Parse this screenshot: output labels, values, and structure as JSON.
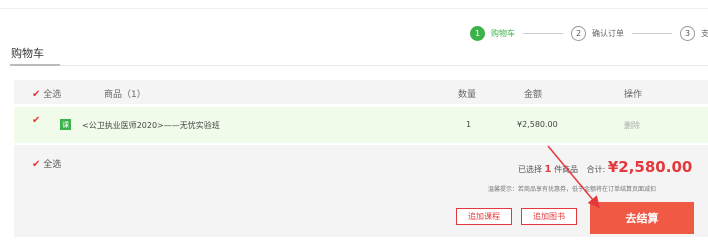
{
  "steps": [
    {
      "num": "1",
      "label": "购物车"
    },
    {
      "num": "2",
      "label": "确认订单"
    },
    {
      "num": "3",
      "label": "支付"
    }
  ],
  "page_title": "购物车",
  "header": {
    "select_all": "全选",
    "product": "商品（1）",
    "quantity": "数量",
    "amount": "金额",
    "action": "操作"
  },
  "item": {
    "badge": "课",
    "name": "<公卫执业医师2020>——无忧实验班",
    "quantity": "1",
    "amount": "¥2,580.00",
    "delete": "删除"
  },
  "footer": {
    "select_all": "全选",
    "selected_prefix": "已选择",
    "selected_count": "1",
    "selected_suffix": "件商品",
    "total_label": "合计:",
    "total_value": "¥2,580.00",
    "tip": "温馨提示：若商品享有优惠券，低于金额将在订单结算页面减扣",
    "add_course": "追加课程",
    "add_book": "追加图书",
    "checkout": "去结算"
  },
  "colors": {
    "accent": "#e4393c",
    "green": "#3cb34a",
    "checkout": "#f05a44"
  }
}
